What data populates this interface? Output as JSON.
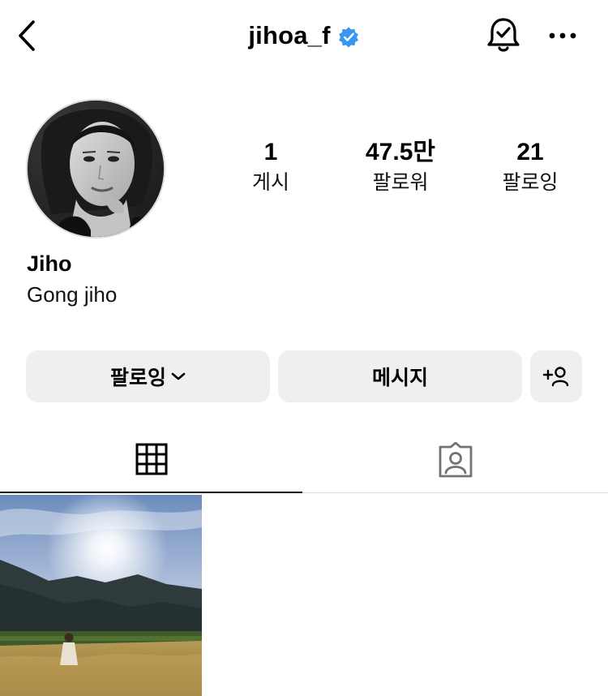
{
  "header": {
    "username": "jihoa_f",
    "verified": true,
    "icons": {
      "back": "chevron-left-icon",
      "verified": "verified-badge-icon",
      "notifications": "bell-check-icon",
      "more": "more-horizontal-icon"
    },
    "verified_color": "#3897f0"
  },
  "profile": {
    "display_name": "Jiho",
    "bio": "Gong jiho",
    "avatar": "profile-photo"
  },
  "stats": {
    "posts": {
      "value": "1",
      "label": "게시"
    },
    "followers": {
      "value": "47.5만",
      "label": "팔로워"
    },
    "following": {
      "value": "21",
      "label": "팔로잉"
    }
  },
  "actions": {
    "following_label": "팔로잉",
    "message_label": "메시지",
    "add_user_icon": "add-person-icon"
  },
  "tabs": [
    {
      "name": "grid",
      "icon": "grid-icon",
      "active": true
    },
    {
      "name": "tagged",
      "icon": "tagged-person-icon",
      "active": false
    }
  ],
  "posts": [
    {
      "description": "landscape-photo"
    }
  ]
}
